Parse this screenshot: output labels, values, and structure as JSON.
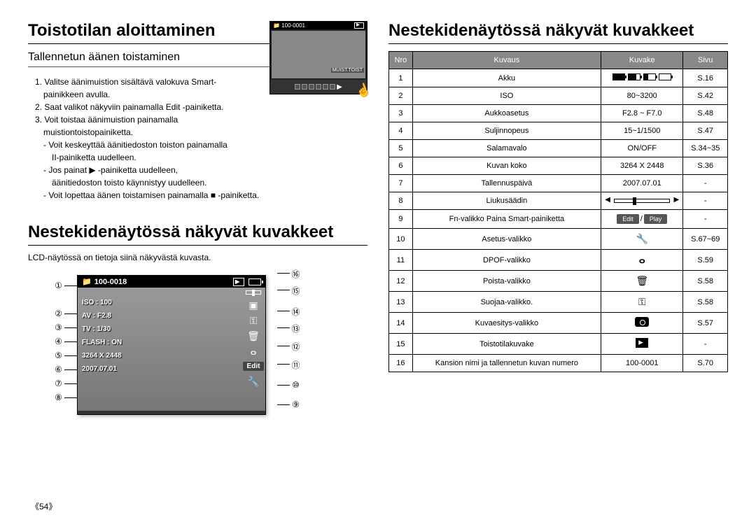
{
  "left": {
    "title1": "Toistotilan aloittaminen",
    "subtitle": "Tallennetun äänen toistaminen",
    "instructions": {
      "i1": "1. Valitse äänimuistion sisältävä valokuva Smart-",
      "i1b": "painikkeen avulla.",
      "i2": "2. Saat valikot näkyviin painamalla Edit -painiketta.",
      "i3": "3. Voit toistaa äänimuistion painamalla",
      "i3b": "muistiontoistopainiketta.",
      "d1": "- Voit keskeyttää äänitiedoston toiston painamalla",
      "d1b": "II-painiketta uudelleen.",
      "d2": "- Jos painat ▶ -painiketta uudelleen,",
      "d2b": "äänitiedoston toisto käynnistyy uudelleen.",
      "d3": "- Voit lopettaa äänen toistamisen painamalla ■ -painiketta."
    },
    "small_lcd": {
      "folder": "100-0001",
      "label": "MUIST.TOIST"
    },
    "title2": "Nestekidenäytössä näkyvät kuvakkeet",
    "desc": "LCD-näytössä on tietoja siinä näkyvästä kuvasta.",
    "lcd": {
      "folder": "100-0018",
      "iso": "ISO : 100",
      "av": "AV : F2.8",
      "tv": "TV : 1/30",
      "flash": "FLASH : ON",
      "size": "3264 X 2448",
      "date": "2007.07.01",
      "edit": "Edit"
    },
    "nums_left": [
      "①",
      "②",
      "③",
      "④",
      "⑤",
      "⑥",
      "⑦",
      "⑧"
    ],
    "nums_right": [
      "⑯",
      "⑮",
      "⑭",
      "⑬",
      "⑫",
      "⑪",
      "⑩",
      "⑨"
    ]
  },
  "right": {
    "title": "Nestekidenäytössä näkyvät kuvakkeet",
    "headers": {
      "no": "Nro",
      "desc": "Kuvaus",
      "icon": "Kuvake",
      "page": "Sivu"
    },
    "rows": [
      {
        "n": "1",
        "desc": "Akku",
        "icon": "battery",
        "page": "S.16"
      },
      {
        "n": "2",
        "desc": "ISO",
        "icon": "80~3200",
        "page": "S.42"
      },
      {
        "n": "3",
        "desc": "Aukkoasetus",
        "icon": "F2.8 ~ F7.0",
        "page": "S.48"
      },
      {
        "n": "4",
        "desc": "Suljinnopeus",
        "icon": "15~1/1500",
        "page": "S.47"
      },
      {
        "n": "5",
        "desc": "Salamavalo",
        "icon": "ON/OFF",
        "page": "S.34~35"
      },
      {
        "n": "6",
        "desc": "Kuvan koko",
        "icon": "3264 X 2448",
        "page": "S.36"
      },
      {
        "n": "7",
        "desc": "Tallennuspäivä",
        "icon": "2007.07.01",
        "page": "-"
      },
      {
        "n": "8",
        "desc": "Liukusäädin",
        "icon": "slider",
        "page": "-"
      },
      {
        "n": "9",
        "desc": "Fn-valikko Paina Smart-painiketta",
        "icon": "editplay",
        "page": "-"
      },
      {
        "n": "10",
        "desc": "Asetus-valikko",
        "icon": "wrench",
        "page": "S.67~69"
      },
      {
        "n": "11",
        "desc": "DPOF-valikko",
        "icon": "dpof",
        "page": "S.59"
      },
      {
        "n": "12",
        "desc": "Poista-valikko",
        "icon": "trash",
        "page": "S.58"
      },
      {
        "n": "13",
        "desc": "Suojaa-valikko.",
        "icon": "key",
        "page": "S.58"
      },
      {
        "n": "14",
        "desc": "Kuvaesitys-valikko",
        "icon": "camera",
        "page": "S.57"
      },
      {
        "n": "15",
        "desc": "Toistotilakuvake",
        "icon": "playbox",
        "page": "-"
      },
      {
        "n": "16",
        "desc": "Kansion nimi ja tallennetun kuvan numero",
        "icon": "100-0001",
        "page": "S.70"
      }
    ],
    "editplay": {
      "edit": "Edit",
      "sep": "/",
      "play": "Play"
    }
  },
  "page_number": "《54》"
}
